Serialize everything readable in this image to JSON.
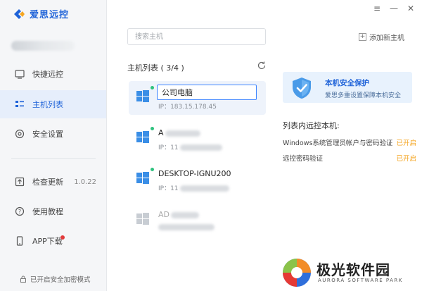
{
  "app": {
    "name": "爱思远控",
    "brand_color": "#1e62d8"
  },
  "window": {
    "controls": [
      "≡",
      "—",
      "✕"
    ]
  },
  "sidebar": {
    "items": [
      {
        "label": "快捷远控",
        "icon": "remote-screen-icon"
      },
      {
        "label": "主机列表",
        "icon": "host-list-icon",
        "active": true
      },
      {
        "label": "安全设置",
        "icon": "security-settings-icon"
      },
      {
        "label": "检查更新",
        "icon": "update-icon",
        "version": "1.0.22"
      },
      {
        "label": "使用教程",
        "icon": "help-icon"
      },
      {
        "label": "APP下载",
        "icon": "phone-icon",
        "badge": "red-dot"
      }
    ],
    "footer": "已开启安全加密模式"
  },
  "search": {
    "placeholder": "搜索主机"
  },
  "host_list": {
    "title": "主机列表 ( 3/4 )",
    "hosts": [
      {
        "name": "公司电脑",
        "ip": "IP：183.15.178.45",
        "online": true,
        "editing": true
      },
      {
        "name": "A",
        "ip": "IP：11",
        "online": true
      },
      {
        "name": "DESKTOP-IGNU200",
        "ip": "IP：11",
        "online": true
      },
      {
        "name": "AD",
        "ip": "",
        "online": false
      }
    ]
  },
  "add_host": {
    "label": "添加新主机"
  },
  "security": {
    "title": "本机安全保护",
    "subtitle": "爱思多重设置保障本机安全"
  },
  "remote_checks": {
    "title": "列表内远控本机:",
    "rows": [
      {
        "label": "Windows系统管理员帐户与密码验证",
        "status": "已开启"
      },
      {
        "label": "远控密码验证",
        "status": "已开启"
      }
    ],
    "status_color": "#f5a623"
  },
  "watermark": {
    "title": "极光软件园",
    "subtitle": "AURORA SOFTWARE PARK"
  }
}
